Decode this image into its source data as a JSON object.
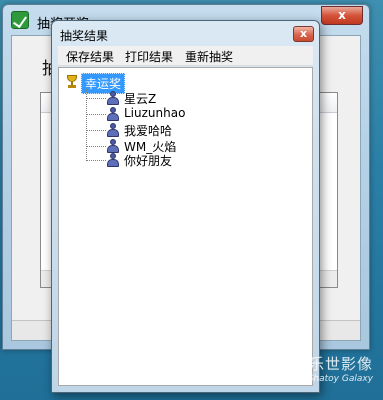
{
  "background_window": {
    "title": "抽奖开奖",
    "close_glyph": "x",
    "label": "抽"
  },
  "dialog": {
    "title": "抽奖结果",
    "close_glyph": "x",
    "menu": [
      {
        "label": "保存结果"
      },
      {
        "label": "打印结果"
      },
      {
        "label": "重新抽奖"
      }
    ],
    "tree": {
      "root": {
        "label": "幸运奖",
        "icon": "trophy-icon",
        "selected": true
      },
      "children": [
        {
          "label": "星云Z",
          "icon": "person-icon"
        },
        {
          "label": "Liuzunhao",
          "icon": "person-icon"
        },
        {
          "label": "我爱哈哈",
          "icon": "person-icon"
        },
        {
          "label": "WM_火焰",
          "icon": "person-icon"
        },
        {
          "label": "你好朋友",
          "icon": "person-icon"
        }
      ]
    }
  },
  "watermark": {
    "main": "墨乐世影像",
    "sub": "Shatoy Galaxy"
  }
}
